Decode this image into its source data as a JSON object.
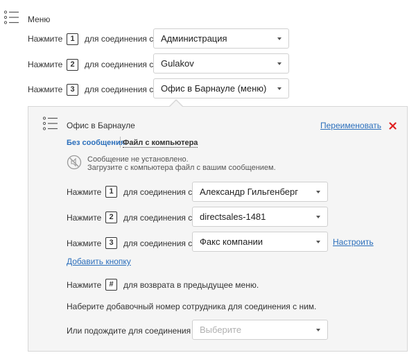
{
  "menu": {
    "title": "Меню",
    "icon": "menu-list-icon",
    "rows": [
      {
        "prefix": "Нажмите",
        "key": "1",
        "mid": "для соединения с",
        "selected": "Администрация"
      },
      {
        "prefix": "Нажмите",
        "key": "2",
        "mid": "для соединения с",
        "selected": "Gulakov"
      },
      {
        "prefix": "Нажмите",
        "key": "3",
        "mid": "для соединения с",
        "selected": "Офис в Барнауле (меню)"
      }
    ]
  },
  "submenu": {
    "title": "Офис в Барнауле",
    "icon": "menu-list-icon",
    "rename_link": "Переименовать",
    "close_icon": "close-icon",
    "close_color": "#e02020",
    "tabs": [
      {
        "label": "Без сообщения",
        "active": true
      },
      {
        "label": "Файл с компьютера",
        "active": false
      }
    ],
    "message": {
      "icon": "no-sound-icon",
      "line1": "Сообщение не установлено.",
      "line2": "Загрузите с компьютера файл с вашим сообщением."
    },
    "rows": [
      {
        "prefix": "Нажмите",
        "key": "1",
        "mid": "для соединения с",
        "selected": "Александр Гильгенберг"
      },
      {
        "prefix": "Нажмите",
        "key": "2",
        "mid": "для соединения с",
        "selected": "directsales-1481"
      },
      {
        "prefix": "Нажмите",
        "key": "3",
        "mid": "для соединения с",
        "selected": "Факс компании",
        "action": "Настроить"
      }
    ],
    "add_button": "Добавить кнопку",
    "back_row": {
      "prefix": "Нажмите",
      "key": "#",
      "suffix": "для возврата в предыдущее меню."
    },
    "extension_text": "Наберите добавочный номер сотрудника для соединения с ним.",
    "wait_row": {
      "prefix": "Или подождите для соединения с",
      "placeholder": "Выберите"
    }
  },
  "colors": {
    "link": "#2a6ebb",
    "panel_bg": "#f5f5f5",
    "border": "#cfcfcf"
  }
}
